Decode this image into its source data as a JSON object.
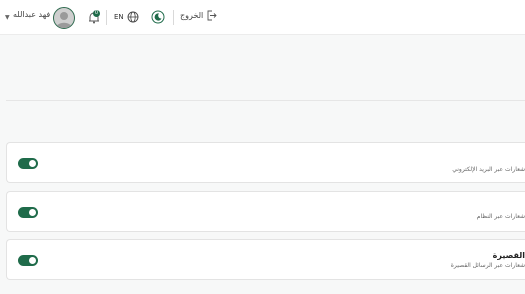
{
  "header": {
    "user_name": "فهد عبدالله",
    "notifications_count": "0",
    "language_label": "EN",
    "logout_label": "الخروج"
  },
  "settings": [
    {
      "title": "",
      "description": "شعارات عبر البريد الإلكتروني",
      "enabled": true
    },
    {
      "title": "",
      "description": "شعارات عبر النظام",
      "enabled": true
    },
    {
      "title": "القصيرة",
      "description": "شعارات عبر الرسائل القصيرة",
      "enabled": true
    }
  ],
  "colors": {
    "accent": "#1f6b4a",
    "background": "#f7f8f8"
  }
}
